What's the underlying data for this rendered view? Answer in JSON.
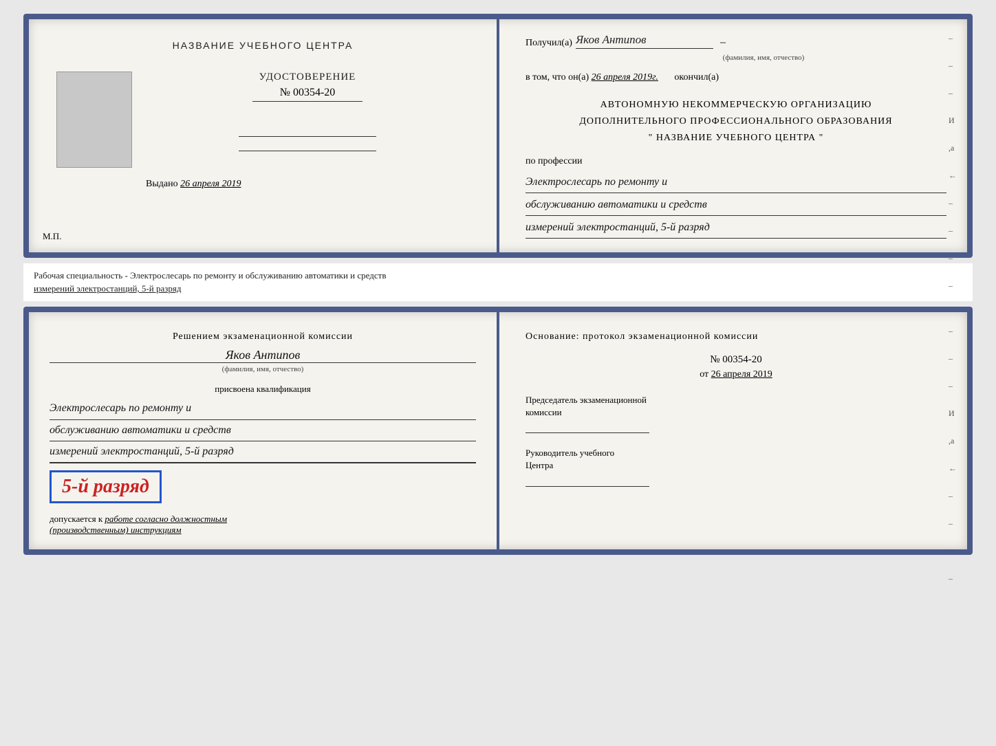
{
  "topBook": {
    "leftPage": {
      "title": "НАЗВАНИЕ УЧЕБНОГО ЦЕНТРА",
      "certTitle": "УДОСТОВЕРЕНИЕ",
      "certNumber": "№ 00354-20",
      "issuedLabel": "Выдано",
      "issuedDate": "26 апреля 2019",
      "mpLabel": "М.П."
    },
    "rightPage": {
      "recipientLabel": "Получил(а)",
      "recipientName": "Яков Антипов",
      "recipientSubtitle": "(фамилия, имя, отчество)",
      "inThatLabel": "в том, что он(а)",
      "inThatDate": "26 апреля 2019г.",
      "finishedLabel": "окончил(а)",
      "orgLine1": "АВТОНОМНУЮ НЕКОММЕРЧЕСКУЮ ОРГАНИЗАЦИЮ",
      "orgLine2": "ДОПОЛНИТЕЛЬНОГО ПРОФЕССИОНАЛЬНОГО ОБРАЗОВАНИЯ",
      "orgLine3": "\"   НАЗВАНИЕ УЧЕБНОГО ЦЕНТРА   \"",
      "professionLabel": "по профессии",
      "professionLine1": "Электрослесарь по ремонту и",
      "professionLine2": "обслуживанию автоматики и средств",
      "professionLine3": "измерений электростанций, 5-й разряд",
      "sideDashes": [
        "-",
        "-",
        "-",
        "И",
        ",а",
        "←",
        "-",
        "-",
        "-",
        "-",
        "-"
      ]
    }
  },
  "specialtyText": {
    "line1": "Рабочая специальность - Электрослесарь по ремонту и обслуживанию автоматики и средств",
    "line2": "измерений электростанций, 5-й разряд"
  },
  "bottomBook": {
    "leftPage": {
      "decisionTitle": "Решением экзаменационной комиссии",
      "personName": "Яков Антипов",
      "fioSubtitle": "(фамилия, имя, отчество)",
      "qualificationLabel": "присвоена квалификация",
      "qualLine1": "Электрослесарь по ремонту и",
      "qualLine2": "обслуживанию автоматики и средств",
      "qualLine3": "измерений электростанций, 5-й разряд",
      "gradeText": "5-й разряд",
      "allowedText": "допускается к",
      "allowedItalic": "работе согласно должностным",
      "allowedItalic2": "(производственным) инструкциям"
    },
    "rightPage": {
      "basisTitle": "Основание: протокол экзаменационной комиссии",
      "protocolNumber": "№  00354-20",
      "protocolDatePrefix": "от",
      "protocolDate": "26 апреля 2019",
      "chairmanTitle": "Председатель экзаменационной",
      "chairmanTitle2": "комиссии",
      "directorTitle": "Руководитель учебного",
      "directorTitle2": "Центра",
      "sideDashes": [
        "-",
        "-",
        "-",
        "И",
        ",а",
        "←",
        "-",
        "-",
        "-",
        "-",
        "-"
      ]
    }
  }
}
